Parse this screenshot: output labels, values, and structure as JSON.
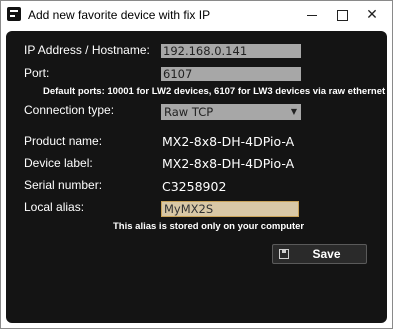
{
  "window": {
    "title": "Add new favorite device with fix IP",
    "controls": {
      "minimize": "minimize",
      "maximize": "maximize",
      "close": "✕"
    }
  },
  "form": {
    "ip": {
      "label": "IP Address / Hostname:",
      "value": "192.168.0.141"
    },
    "port": {
      "label": "Port:",
      "value": "6107"
    },
    "port_note": "Default ports: 10001 for LW2 devices, 6107 for LW3 devices via raw ethernet",
    "connection": {
      "label": "Connection type:",
      "value": "Raw TCP"
    },
    "product": {
      "label": "Product name:",
      "value": "MX2-8x8-DH-4DPio-A"
    },
    "device_label": {
      "label": "Device label:",
      "value": "MX2-8x8-DH-4DPio-A"
    },
    "serial": {
      "label": "Serial number:",
      "value": "C3258902"
    },
    "alias": {
      "label": "Local alias:",
      "value": "MyMX2S"
    },
    "alias_note": "This alias is stored only on your computer",
    "save_label": "Save"
  },
  "colors": {
    "dialog_bg": "#141414",
    "field_bg": "#a7a7a7",
    "alias_bg": "#d9c8a6",
    "alias_border": "#c9a35a"
  }
}
